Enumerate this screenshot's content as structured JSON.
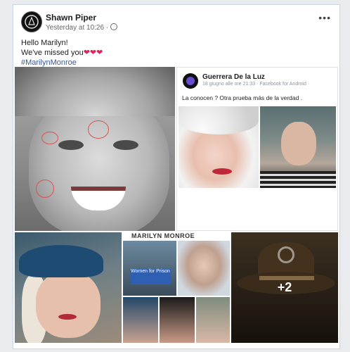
{
  "post": {
    "author": "Shawn Piper",
    "timestamp": "Yesterday at 10:26 ·",
    "privacy_icon": "globe-icon",
    "more_label": "•••",
    "lines": {
      "l1": "Hello Marilyn!",
      "l2": "We've missed you",
      "hearts": "❤❤❤",
      "hashtag": "#MarilynMonroe"
    }
  },
  "shared_post": {
    "author": "Guerrera De la Luz",
    "meta": "18 giugno alle ore 21:33 · Facebook for Android ·",
    "text": "La conocen ? Otra prueba más de la verdad ."
  },
  "collage": {
    "title": "MARILYN MONROE",
    "sign_text": "Women for Prison"
  },
  "more_photos": "+2",
  "colors": {
    "link": "#385898",
    "hearts": "#e0245e",
    "border": "#c9d6ea"
  }
}
